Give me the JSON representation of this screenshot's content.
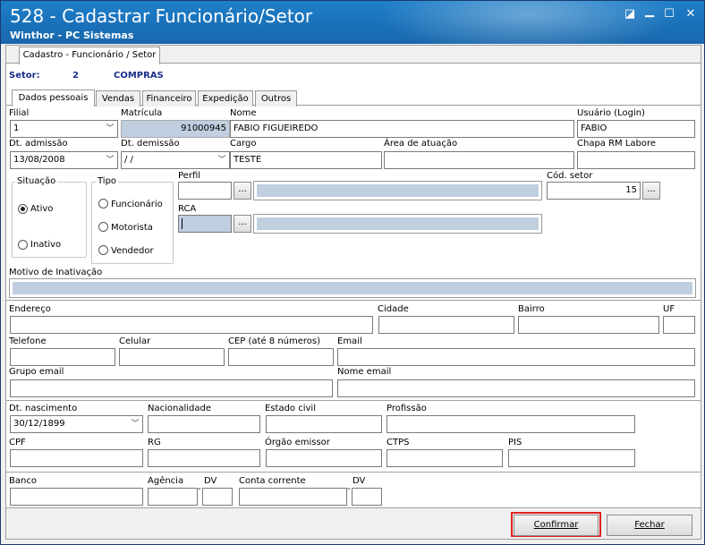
{
  "window": {
    "title": "528 - Cadastrar Funcionário/Setor",
    "subtitle": "Winthor - PC Sistemas",
    "controls": {
      "restore": "◪",
      "minimize": "▁",
      "maximize": "☐",
      "close": "✕"
    }
  },
  "header_tab": "Cadastro - Funcionário / Setor",
  "setor": {
    "label": "Setor:",
    "code": "2",
    "name": "COMPRAS"
  },
  "tabs": [
    "Dados pessoais",
    "Vendas",
    "Financeiro",
    "Expedição",
    "Outros"
  ],
  "fields": {
    "filial": {
      "label": "Filial",
      "value": "1"
    },
    "matricula": {
      "label": "Matrícula",
      "value": "91000945"
    },
    "nome": {
      "label": "Nome",
      "value": "FABIO FIGUEIREDO"
    },
    "usuario": {
      "label": "Usuário (Login)",
      "value": "FABIO"
    },
    "dt_admissao": {
      "label": "Dt. admissão",
      "value": "13/08/2008"
    },
    "dt_demissao": {
      "label": "Dt.  demissão",
      "value": " / /"
    },
    "cargo": {
      "label": "Cargo",
      "value": "TESTE"
    },
    "area_atuacao": {
      "label": "Área de atuação",
      "value": ""
    },
    "chapa": {
      "label": "Chapa RM Labore",
      "value": ""
    },
    "perfil": {
      "label": "Perfil",
      "value": ""
    },
    "cod_setor": {
      "label": "Cód. setor",
      "value": "15"
    },
    "rca": {
      "label": "RCA",
      "value": ""
    },
    "motivo_inativacao": {
      "label": "Motivo de Inativação",
      "value": ""
    },
    "endereco": {
      "label": "Endereço",
      "value": ""
    },
    "cidade": {
      "label": "Cidade",
      "value": ""
    },
    "bairro": {
      "label": "Bairro",
      "value": ""
    },
    "uf": {
      "label": "UF",
      "value": ""
    },
    "telefone": {
      "label": "Telefone",
      "value": ""
    },
    "celular": {
      "label": "Celular",
      "value": ""
    },
    "cep": {
      "label": "CEP (até 8 números)",
      "value": ""
    },
    "email": {
      "label": "Email",
      "value": ""
    },
    "grupo_email": {
      "label": "Grupo email",
      "value": ""
    },
    "nome_email": {
      "label": "Nome email",
      "value": ""
    },
    "dt_nascimento": {
      "label": "Dt. nascimento",
      "value": "30/12/1899"
    },
    "nacionalidade": {
      "label": "Nacionalidade",
      "value": ""
    },
    "estado_civil": {
      "label": "Estado civil",
      "value": ""
    },
    "profissao": {
      "label": "Profissão",
      "value": ""
    },
    "cpf": {
      "label": "CPF",
      "value": ""
    },
    "rg": {
      "label": "RG",
      "value": ""
    },
    "orgao_emissor": {
      "label": "Órgão emissor",
      "value": ""
    },
    "ctps": {
      "label": "CTPS",
      "value": ""
    },
    "pis": {
      "label": "PIS",
      "value": ""
    },
    "banco": {
      "label": "Banco",
      "value": ""
    },
    "agencia": {
      "label": "Agência",
      "value": ""
    },
    "agencia_dv": {
      "label": "DV",
      "value": ""
    },
    "conta_corrente": {
      "label": "Conta corrente",
      "value": ""
    },
    "conta_dv": {
      "label": "DV",
      "value": ""
    }
  },
  "situacao": {
    "label": "Situação",
    "options": [
      "Ativo",
      "Inativo"
    ],
    "selected": "Ativo"
  },
  "tipo": {
    "label": "Tipo",
    "options": [
      "Funcionário",
      "Motorista",
      "Vendedor"
    ],
    "selected": ""
  },
  "browse_label": "...",
  "dash": "-",
  "buttons": {
    "confirmar": "Confirmar",
    "fechar": "Fechar"
  },
  "colors": {
    "title_bar": "#1a72ba",
    "disabled_field": "#bfcfe0",
    "setor_text": "#1a2f8a",
    "highlight": "#e02020"
  }
}
